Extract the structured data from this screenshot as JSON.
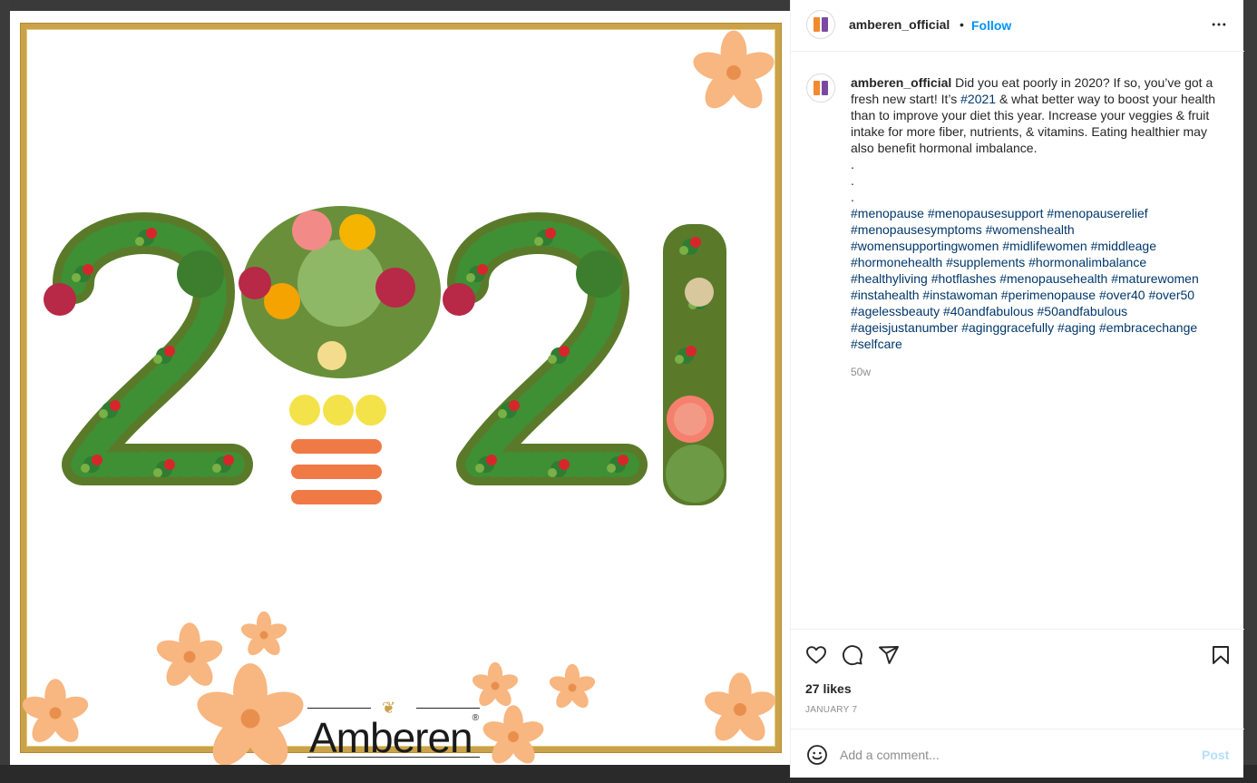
{
  "post": {
    "image_alt": "2021 spelled with fruits and vegetables",
    "image_headline": "2021",
    "brand_wordmark": "Amberen",
    "brand_mark": "®"
  },
  "header": {
    "username": "amberen_official",
    "separator": "•",
    "follow_label": "Follow",
    "more_icon": "more-horizontal-icon"
  },
  "caption": {
    "username": "amberen_official",
    "text_before": "Did you eat poorly in 2020? If so, you’ve got a fresh new start! It’s",
    "inline_tag": "#2021",
    "text_after": "& what better way to boost your health than to improve your diet this year. Increase your veggies & fruit intake for more fiber, nutrients, & vitamins. Eating healthier may also benefit hormonal imbalance.",
    "dots": [
      ".",
      ".",
      "."
    ],
    "hashtags": [
      "#menopause",
      "#menopausesupport",
      "#menopauserelief",
      "#menopausesymptoms",
      "#womenshealth",
      "#womensupportingwomen",
      "#midlifewomen",
      "#middleage",
      "#hormonehealth",
      "#supplements",
      "#hormonalimbalance",
      "#healthyliving",
      "#hotflashes",
      "#menopausehealth",
      "#maturewomen",
      "#instahealth",
      "#instawoman",
      "#perimenopause",
      "#over40",
      "#over50",
      "#agelessbeauty",
      "#40andfabulous",
      "#50andfabulous",
      "#ageisjustanumber",
      "#aginggracefully",
      "#aging",
      "#embracechange",
      "#selfcare"
    ],
    "time_ago": "50w"
  },
  "actions": {
    "like_icon": "heart-icon",
    "comment_icon": "comment-icon",
    "share_icon": "share-icon",
    "save_icon": "bookmark-icon",
    "likes_text": "27 likes",
    "date_text": "JANUARY 7"
  },
  "comment": {
    "emoji_icon": "emoji-icon",
    "placeholder": "Add a comment...",
    "post_label": "Post"
  },
  "colors": {
    "link_blue": "#0095f6",
    "hashtag_blue": "#00376b",
    "gold_frame": "#c9a24a",
    "flower_peach": "#f6b27a"
  }
}
